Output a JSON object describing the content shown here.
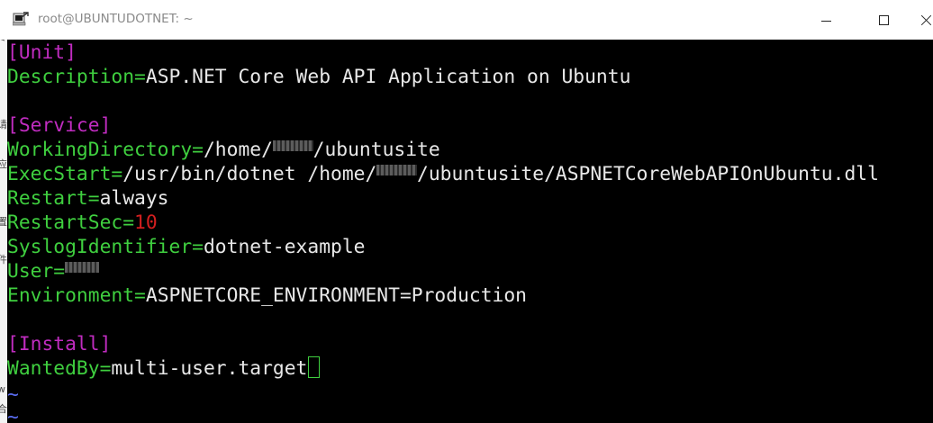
{
  "window": {
    "title": "root@UBUNTUDOTNET: ~",
    "icon": "putty-terminal-icon"
  },
  "left_strip": {
    "glyphs": [
      "<",
      "请",
      "应",
      "置",
      "件",
      "w",
      "合"
    ]
  },
  "file": {
    "unit_header": "[Unit]",
    "description_key": "Description=",
    "description_value": "ASP.NET Core Web API Application on Ubuntu",
    "service_header": "[Service]",
    "workdir_key": "WorkingDirectory=",
    "workdir_prefix": "/home/",
    "workdir_suffix": "/ubuntusite",
    "execstart_key": "ExecStart=",
    "execstart_prefix": "/usr/bin/dotnet /home/",
    "execstart_suffix": "/ubuntusite/ASPNETCoreWebAPIOnUbuntu.dll",
    "restart_key": "Restart=",
    "restart_value": "always",
    "restartsec_key": "RestartSec=",
    "restartsec_value": "10",
    "syslog_key": "SyslogIdentifier=",
    "syslog_value": "dotnet-example",
    "user_key": "User=",
    "environment_key": "Environment=",
    "environment_value": "ASPNETCORE_ENVIRONMENT=Production",
    "install_header": "[Install]",
    "wantedby_key": "WantedBy=",
    "wantedby_value": "multi-user.target",
    "tilde_lines": [
      "~",
      "~"
    ]
  },
  "colors": {
    "section_header": "#c02cc0",
    "key": "#3fcf3f",
    "value": "#e8e8e8",
    "number": "#d21f1f",
    "tilde": "#5a6cf0",
    "background": "#000000"
  }
}
